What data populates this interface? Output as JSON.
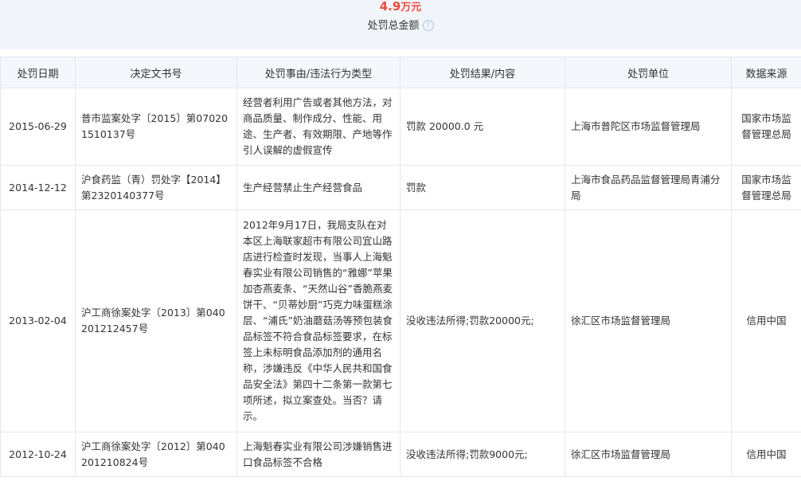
{
  "summary": {
    "amount_value": "4.9",
    "amount_unit": "万元",
    "label": "处罚总金额",
    "help_glyph": "?"
  },
  "table": {
    "headers": [
      "处罚日期",
      "决定文书号",
      "处罚事由/违法行为类型",
      "处罚结果/内容",
      "处罚单位",
      "数据来源"
    ],
    "rows": [
      {
        "date": "2015-06-29",
        "doc_no": "普市监案处字〔2015〕第070201510137号",
        "reason": "经营者利用广告或者其他方法，对商品质量、制作成分、性能、用途、生产者、有效期限、产地等作引人误解的虚假宣传",
        "result": "罚款 20000.0 元",
        "unit": "上海市普陀区市场监督管理局",
        "source": "国家市场监督管理总局"
      },
      {
        "date": "2014-12-12",
        "doc_no": "沪食药监（青）罚处字【2014】第2320140377号",
        "reason": "生产经营禁止生产经营食品",
        "result": "罚款",
        "unit": "上海市食品药品监督管理局青浦分局",
        "source": "国家市场监督管理总局"
      },
      {
        "date": "2013-02-04",
        "doc_no": "沪工商徐案处字〔2013〕第040201212457号",
        "reason": "2012年9月17日，我局支队在对本区上海联家超市有限公司宜山路店进行检查时发现，当事人上海魁春实业有限公司销售的“雅娜”苹果加杏燕麦条、“天然山谷”香脆燕麦饼干、“贝蒂妙厨”巧克力味蛋糕涂层、“浦氏”奶油蘑菇汤等预包装食品标签不符合食品标签要求，在标签上未标明食品添加剂的通用名称，涉嫌违反《中华人民共和国食品安全法》第四十二条第一款第七项所述，拟立案查处。当否？请示。",
        "result": "没收违法所得;罚款20000元;",
        "unit": "徐汇区市场监督管理局",
        "source": "信用中国"
      },
      {
        "date": "2012-10-24",
        "doc_no": "沪工商徐案处字〔2012〕第040201210824号",
        "reason": "上海魁春实业有限公司涉嫌销售进口食品标签不合格",
        "result": "没收违法所得;罚款9000元;",
        "unit": "徐汇区市场监督管理局",
        "source": "信用中国"
      }
    ]
  },
  "colors": {
    "amount": "#f04a3c",
    "summary_bg": "#f1f5fa",
    "header_bg": "#f4f7fb",
    "border": "#e3e8ef",
    "help_icon": "#a9c4e4"
  }
}
